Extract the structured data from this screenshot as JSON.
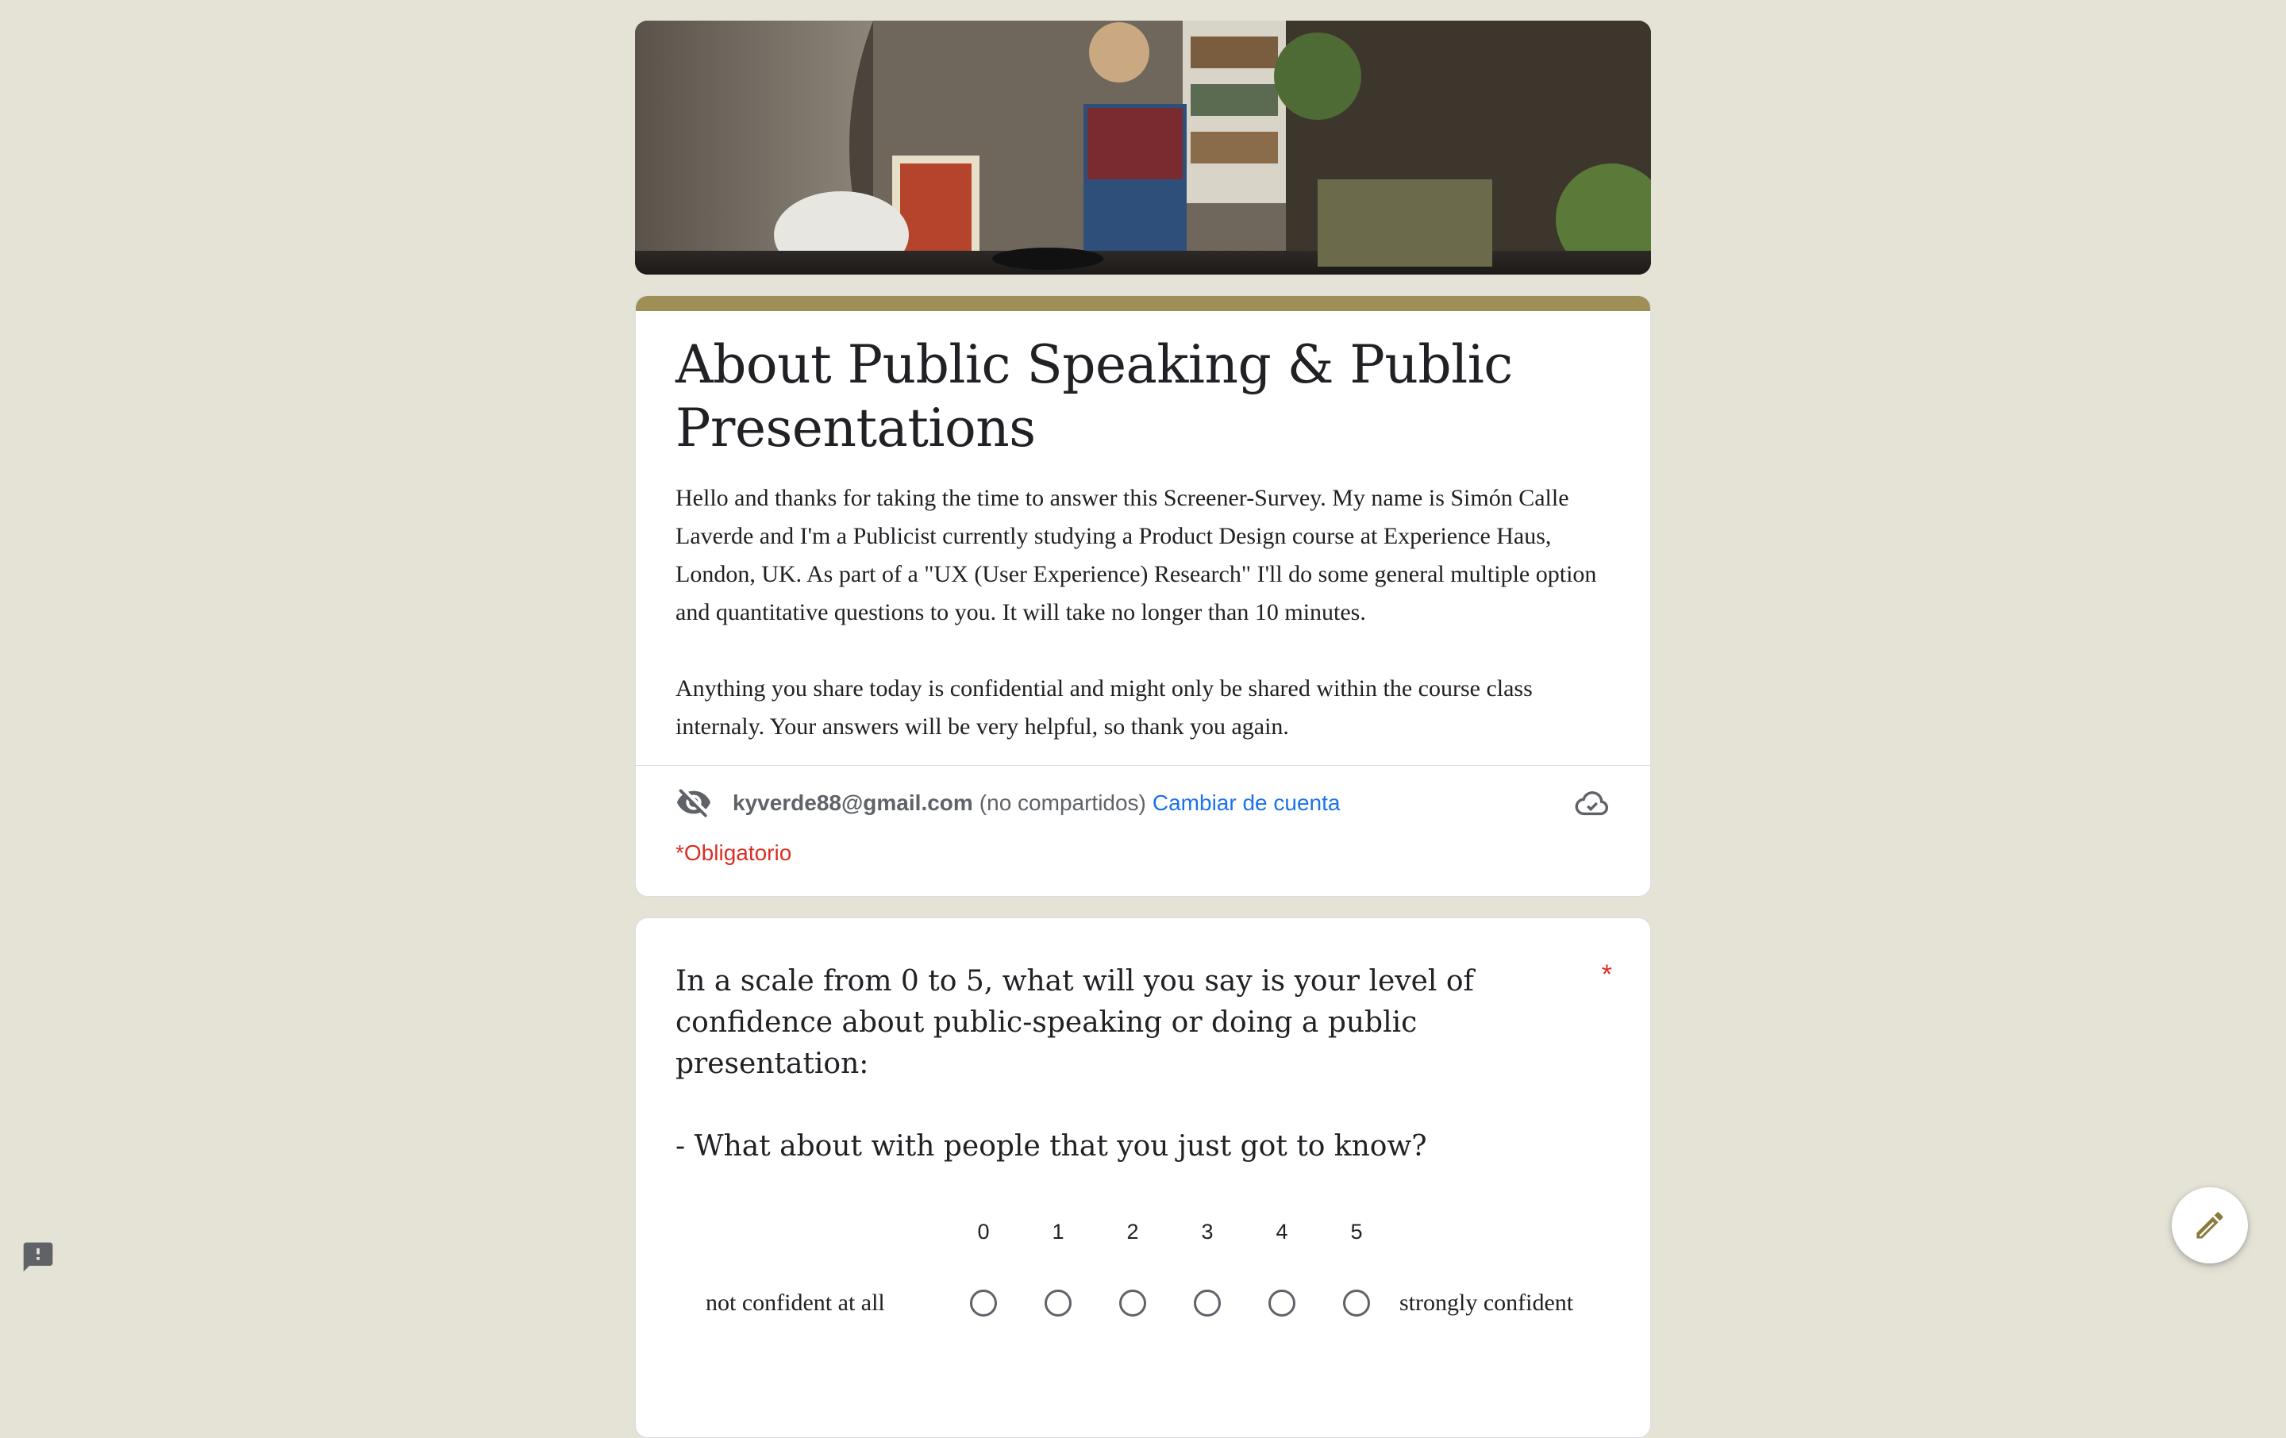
{
  "form": {
    "title": "About Public Speaking & Public Presentations",
    "description": [
      "Hello and thanks for taking the time to answer this Screener-Survey. My name is Simón Calle Laverde and I'm a Publicist currently studying a Product Design course at Experience Haus, London, UK. As part of a \"UX (User Experience) Research\" I'll do some general multiple option and quantitative questions to you. It will take no longer than 10 minutes.",
      "Anything you share today is confidential and might only be shared within the course class internaly. Your answers will be very helpful, so thank you again."
    ],
    "accent_color": "#9e8f56",
    "background_color": "#e5e2d6"
  },
  "account": {
    "email": "kyverde88@gmail.com",
    "visibility_note": "(no compartidos)",
    "switch_label": "Cambiar de cuenta",
    "hidden_icon": "eye-off-icon",
    "save_icon": "cloud-check-icon"
  },
  "required_note": "*Obligatorio",
  "question": {
    "lines": [
      "In a scale from 0 to 5, what will you say is your level of confidence about public-speaking or doing a public presentation:",
      "- What about with people that you just got to know?"
    ],
    "required_marker": "*",
    "scale": {
      "low_label": "not confident at all",
      "high_label": "strongly confident",
      "options": [
        "0",
        "1",
        "2",
        "3",
        "4",
        "5"
      ]
    }
  },
  "floating": {
    "edit_icon": "pencil-icon",
    "report_icon": "report-icon"
  }
}
